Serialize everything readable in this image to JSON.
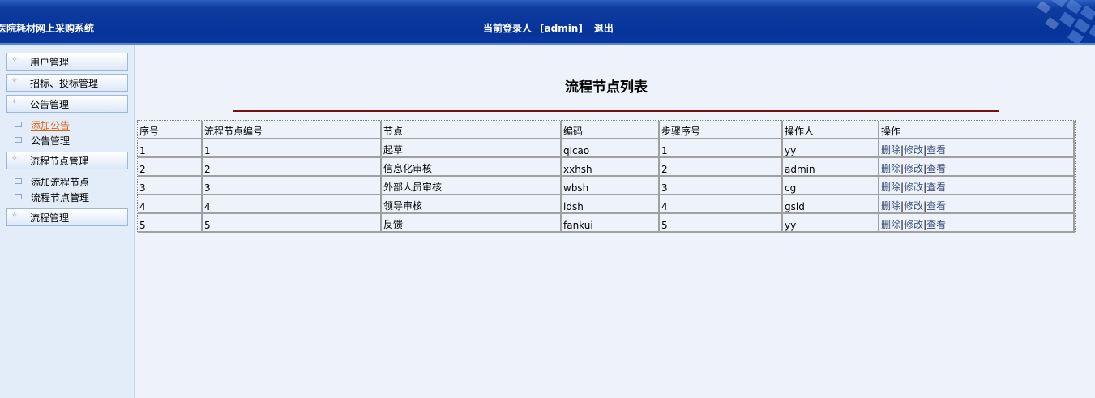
{
  "header": {
    "system_title": "医院耗材网上采购系统",
    "current_user_label": "当前登录人",
    "username": "[admin]",
    "logout": "退出"
  },
  "sidebar": {
    "groups": [
      {
        "label": "用户管理"
      },
      {
        "label": "招标、投标管理"
      },
      {
        "label": "公告管理",
        "items": [
          {
            "label": "添加公告",
            "active": true
          },
          {
            "label": "公告管理"
          }
        ]
      },
      {
        "label": "流程节点管理",
        "items": [
          {
            "label": "添加流程节点"
          },
          {
            "label": "流程节点管理"
          }
        ]
      },
      {
        "label": "流程管理"
      }
    ]
  },
  "main": {
    "title": "流程节点列表",
    "table": {
      "headers": [
        "序号",
        "流程节点编号",
        "节点",
        "编码",
        "步骤序号",
        "操作人",
        "操作"
      ],
      "rows": [
        [
          "1",
          "1",
          "起草",
          "qicao",
          "1",
          "yy"
        ],
        [
          "2",
          "2",
          "信息化审核",
          "xxhsh",
          "2",
          "admin"
        ],
        [
          "3",
          "3",
          "外部人员审核",
          "wbsh",
          "3",
          "cg"
        ],
        [
          "4",
          "4",
          "领导审核",
          "ldsh",
          "4",
          "gsld"
        ],
        [
          "5",
          "5",
          "反馈",
          "fankui",
          "5",
          "yy"
        ]
      ],
      "actions": {
        "delete": "删除",
        "edit": "修改",
        "view": "查看",
        "sep": "|"
      }
    }
  }
}
